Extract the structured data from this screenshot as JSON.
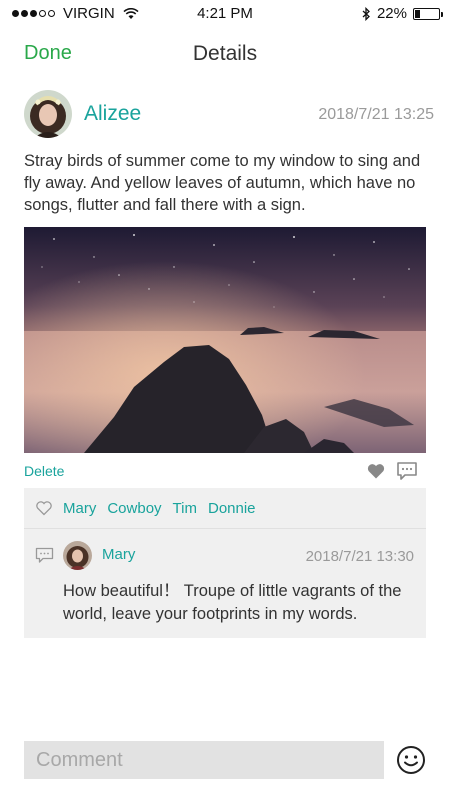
{
  "status_bar": {
    "carrier": "VIRGIN",
    "time": "4:21 PM",
    "battery": "22%",
    "battery_level": 0.22
  },
  "nav": {
    "done_label": "Done",
    "title": "Details"
  },
  "post": {
    "author": "Alizee",
    "timestamp": "2018/7/21 13:25",
    "text": "Stray birds of summer come to my window to sing and fly away. And yellow leaves of autumn, which have no songs, flutter and fall there with a sign.",
    "delete_label": "Delete"
  },
  "likes": {
    "names": [
      "Mary",
      "Cowboy",
      "Tim",
      "Donnie"
    ]
  },
  "comments": [
    {
      "author": "Mary",
      "timestamp": "2018/7/21 13:30",
      "text": "How beautiful！ Troupe of little vagrants of the world, leave your footprints in my words."
    }
  ],
  "comment_bar": {
    "placeholder": "Comment"
  },
  "colors": {
    "accent_green": "#2aa84a",
    "accent_teal": "#19a39c",
    "muted_gray": "#9a9a9a",
    "panel_bg": "#f0f0f0"
  },
  "icons": {
    "signal": "signal-dots-icon",
    "wifi": "wifi-icon",
    "bluetooth": "bluetooth-icon",
    "battery": "battery-icon",
    "like": "heart-icon",
    "comment": "comment-bubble-icon",
    "likes_heart": "heart-outline-icon",
    "emoji": "smiley-icon"
  }
}
